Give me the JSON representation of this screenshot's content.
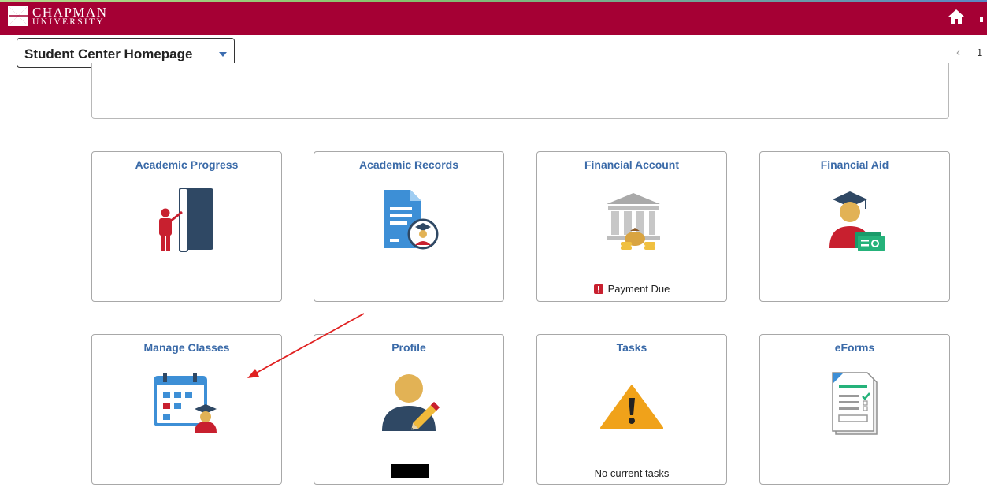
{
  "header": {
    "logo_line1": "CHAPMAN",
    "logo_line2": "UNIVERSITY",
    "brand_color": "#a50034",
    "home_icon": "home-icon"
  },
  "navbar": {
    "page_selector_label": "Student Center Homepage",
    "pager_prev_glyph": "‹",
    "pager_page": "1"
  },
  "tiles": [
    {
      "title": "Academic Progress",
      "icon": "academic-progress-icon",
      "status": ""
    },
    {
      "title": "Academic Records",
      "icon": "academic-records-icon",
      "status": ""
    },
    {
      "title": "Financial Account",
      "icon": "financial-account-icon",
      "status": "Payment Due"
    },
    {
      "title": "Financial Aid",
      "icon": "financial-aid-icon",
      "status": ""
    },
    {
      "title": "Manage Classes",
      "icon": "manage-classes-icon",
      "status": ""
    },
    {
      "title": "Profile",
      "icon": "profile-icon",
      "status": ""
    },
    {
      "title": "Tasks",
      "icon": "tasks-warning-icon",
      "status": "No current tasks"
    },
    {
      "title": "eForms",
      "icon": "eforms-icon",
      "status": ""
    }
  ],
  "colors": {
    "tile_title": "#3a6aa8",
    "alert_red": "#c8202f",
    "annotation_arrow": "#e02020"
  }
}
